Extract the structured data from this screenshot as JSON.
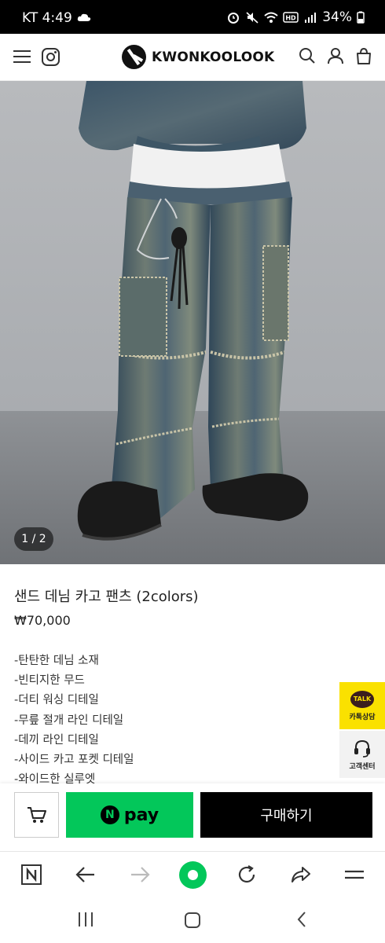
{
  "status_bar": {
    "carrier_time": "KT 4:49",
    "battery": "34%"
  },
  "header": {
    "brand": "KWONKOOLOOK"
  },
  "gallery": {
    "pager": "1 / 2"
  },
  "product": {
    "title": "샌드 데님 카고 팬츠 (2colors)",
    "price": "₩70,000",
    "description": [
      "-탄탄한 데님 소재",
      "-빈티지한 무드",
      "-더티 워싱 디테일",
      "-무릎 절개 라인 디테일",
      "-데끼 라인 디테일",
      "-사이드 카고 포켓 디테일",
      "-와이드한 실루엣"
    ]
  },
  "floating": {
    "talk_badge": "TALK",
    "talk_label": "카톡상담",
    "service_label": "고객센터"
  },
  "buy_bar": {
    "npay_n": "N",
    "npay_label": "pay",
    "buy_label": "구매하기"
  },
  "colors": {
    "npay_green": "#03c75a",
    "kakao_yellow": "#fae100",
    "buy_black": "#000000"
  }
}
